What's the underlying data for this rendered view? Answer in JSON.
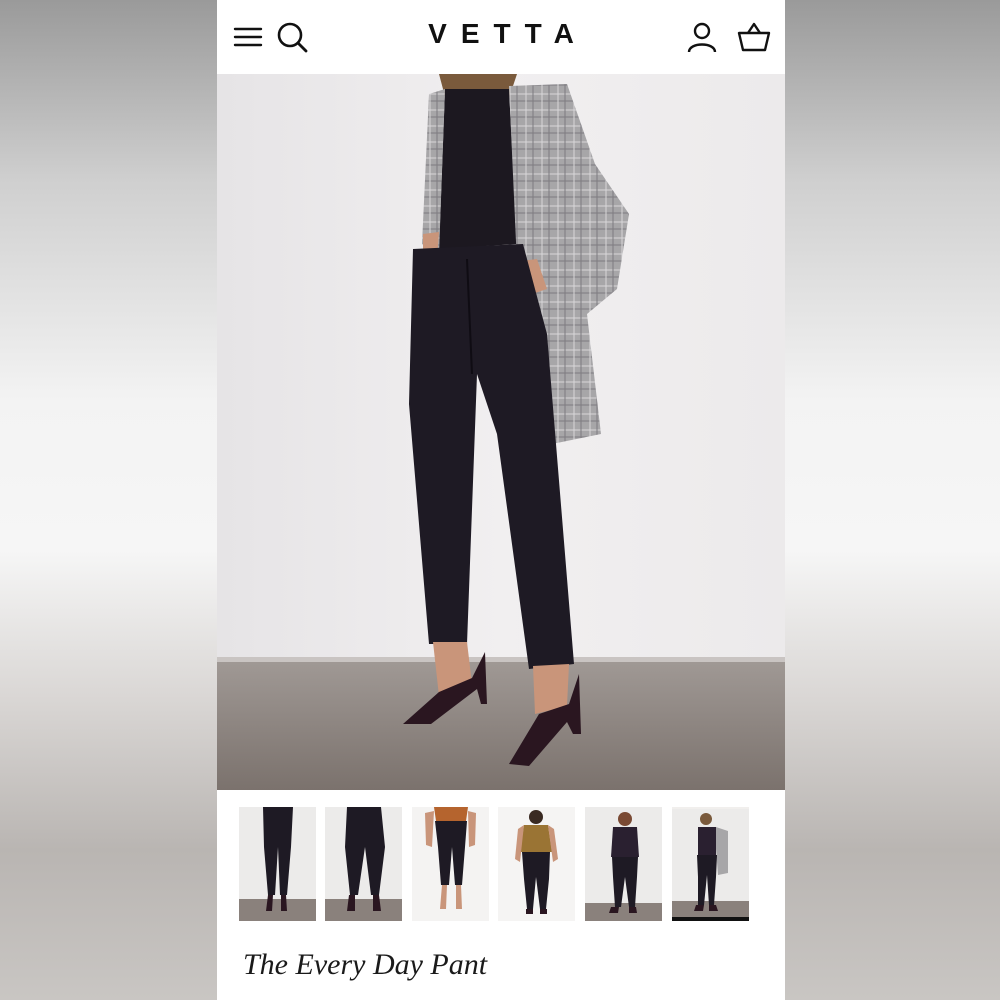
{
  "header": {
    "brand": "VETTA",
    "menu_icon": "hamburger-menu-icon",
    "search_icon": "search-icon",
    "account_icon": "user-account-icon",
    "cart_icon": "shopping-basket-icon"
  },
  "product": {
    "title": "The Every Day Pant",
    "thumbnails": [
      {
        "view": "front"
      },
      {
        "view": "back"
      },
      {
        "view": "styled-orange-top"
      },
      {
        "view": "styled-tan-tee"
      },
      {
        "view": "styled-black-top"
      },
      {
        "view": "styled-plaid-blazer",
        "selected": true
      }
    ]
  },
  "colors": {
    "pant": "#1e1a24",
    "floor": "#8f8782",
    "wall": "#eeeced"
  }
}
